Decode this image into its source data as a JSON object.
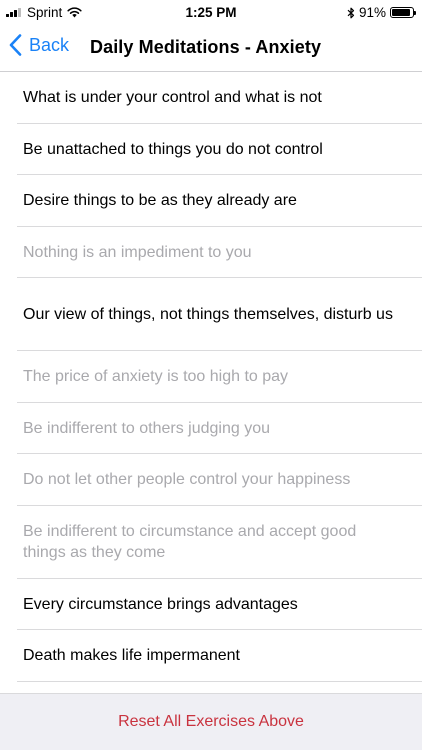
{
  "status_bar": {
    "carrier": "Sprint",
    "time": "1:25 PM",
    "battery_percent": "91%",
    "battery_level": 0.91,
    "icons": [
      "signal-icon",
      "wifi-icon",
      "bluetooth-icon",
      "battery-icon"
    ]
  },
  "nav": {
    "back_label": "Back",
    "title": "Daily Meditations - Anxiety",
    "accent_color": "#1a82f7"
  },
  "meditations": [
    {
      "text": "What is under your control and what is not",
      "enabled": true
    },
    {
      "text": "Be unattached to things you do not control",
      "enabled": true
    },
    {
      "text": "Desire things to be as they already are",
      "enabled": true
    },
    {
      "text": "Nothing is an impediment to you",
      "enabled": false
    },
    {
      "text": "Our view of things, not things themselves, disturb us",
      "enabled": true
    },
    {
      "text": "The price of anxiety is too high to pay",
      "enabled": false
    },
    {
      "text": "Be indifferent to others judging you",
      "enabled": false
    },
    {
      "text": "Do not let other people control your happiness",
      "enabled": false
    },
    {
      "text": "Be indifferent to circumstance and accept good things as they come",
      "enabled": false
    },
    {
      "text": "Every circumstance brings advantages",
      "enabled": true
    },
    {
      "text": "Death makes life impermanent",
      "enabled": true
    }
  ],
  "footer": {
    "reset_label": "Reset All Exercises Above",
    "reset_color": "#c9333f"
  }
}
